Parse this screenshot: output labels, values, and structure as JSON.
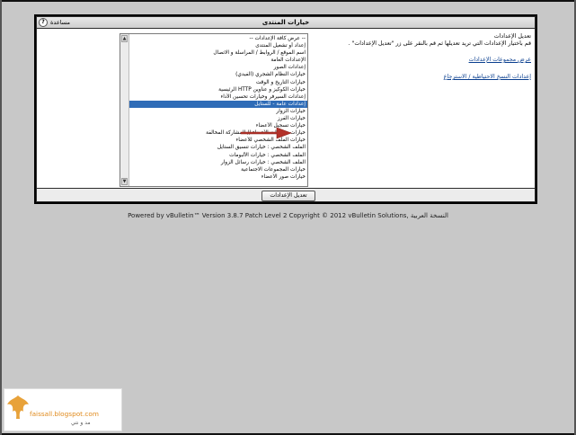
{
  "panel": {
    "title": "خيارات المنتدى",
    "help_label": "مساعدة",
    "submit_label": "تعديل الإعدادات"
  },
  "settings_list": [
    "-- عرض كافة الإعدادات --",
    "إعداد أو تشغيل المنتدى",
    "اسم الموقع / الروابط / المراسلة و الاتصال",
    "الإعدادات العامة",
    "إعدادات الصور",
    "خيارات النظام الشجري (الفيدي)",
    "خيارات التاريخ و الوقت",
    "خيارات الكوكيز و عناوين HTTP الرئيسية",
    "إعدادات السيرفر وخيارات تحسين الأداء",
    "إعدادات عامة - للستايل",
    "خيارات الزوار",
    "خيارات الفرز",
    "خيارات تسجيل الأعضاء",
    "خيارات مخالفات الأعضاء // المشاركة المخالفة",
    "خيارات الملف الشخصي للأعضاء",
    "الملف الشخصي : خيارات تنسيق الستايل",
    "الملف الشخصي : خيارات الألبومات",
    "الملف الشخصي : خيارات رسائل الزوار",
    "خيارات المجموعات الاجتماعية",
    "خيارات صور الأعضاء"
  ],
  "selected_index": 9,
  "right_panel": {
    "heading": "تعديل الإعدادات",
    "description": "قم باختيار الإعدادات التي تريد تعديلها ثم قم بالنقر على زر \"تعديل الإعدادات\" .",
    "links": [
      "عرض مجموعات الإعدادات",
      "إعدادات النسخ الاحتياطية / الاسترجاع"
    ]
  },
  "footer": {
    "powered_by": "Powered by vBulletin™ Version 3.8.7 Patch Level 2 Copyright © 2012 vBulletin Solutions",
    "arabic_label": "النسخة العربية"
  },
  "logo": {
    "site": "faissall.blogspot.com",
    "tagline": "مد و نتي"
  },
  "colors": {
    "selection": "#2f6cb7",
    "arrow": "#b3322a",
    "link": "#0a3f8f"
  }
}
